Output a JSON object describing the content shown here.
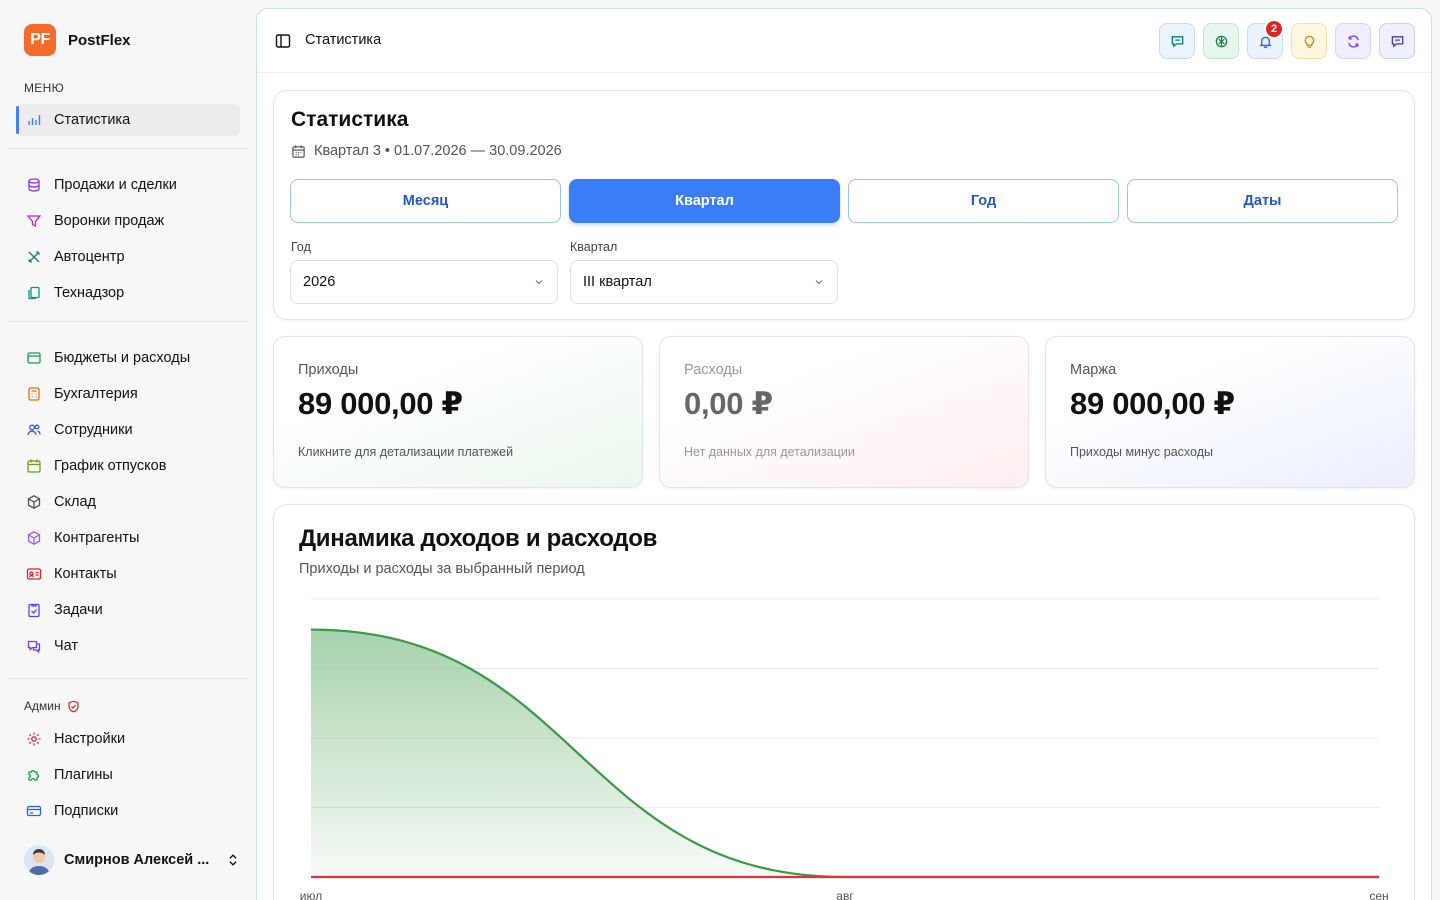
{
  "app": {
    "logo_text": "PF",
    "name": "PostFlex"
  },
  "sidebar": {
    "menu_label": "МЕНЮ",
    "items_main": [
      {
        "label": "Статистика",
        "icon": "bar-chart-icon"
      }
    ],
    "items_sales": [
      {
        "label": "Продажи и сделки",
        "icon": "database-icon"
      },
      {
        "label": "Воронки продаж",
        "icon": "funnel-icon"
      },
      {
        "label": "Автоцентр",
        "icon": "wrench-icon"
      },
      {
        "label": "Технадзор",
        "icon": "copy-icon"
      }
    ],
    "items_ops": [
      {
        "label": "Бюджеты и расходы",
        "icon": "wallet-icon"
      },
      {
        "label": "Бухгалтерия",
        "icon": "calculator-icon"
      },
      {
        "label": "Сотрудники",
        "icon": "users-icon"
      },
      {
        "label": "График отпусков",
        "icon": "calendar-icon"
      },
      {
        "label": "Склад",
        "icon": "box-icon"
      },
      {
        "label": "Контрагенты",
        "icon": "package-icon"
      },
      {
        "label": "Контакты",
        "icon": "contact-card-icon"
      },
      {
        "label": "Задачи",
        "icon": "clipboard-icon"
      },
      {
        "label": "Чат",
        "icon": "chat-icon"
      }
    ],
    "admin_label": "Админ",
    "items_admin": [
      {
        "label": "Настройки",
        "icon": "gear-icon"
      },
      {
        "label": "Плагины",
        "icon": "puzzle-icon"
      },
      {
        "label": "Подписки",
        "icon": "credit-card-icon"
      }
    ],
    "user_name": "Смирнов Алексей ..."
  },
  "topbar": {
    "breadcrumb": "Статистика",
    "notifications_count": "2"
  },
  "stats": {
    "title": "Статистика",
    "period": "Квартал 3 • 01.07.2026 — 30.09.2026",
    "tabs": [
      "Месяц",
      "Квартал",
      "Год",
      "Даты"
    ],
    "active_tab": "Квартал",
    "year_label": "Год",
    "year_value": "2026",
    "quarter_label": "Квартал",
    "quarter_value": "III квартал"
  },
  "kpis": {
    "income": {
      "label": "Приходы",
      "value": "89 000,00 ₽",
      "note": "Кликните для детализации платежей"
    },
    "expense": {
      "label": "Расходы",
      "value": "0,00 ₽",
      "note": "Нет данных для детализации"
    },
    "margin": {
      "label": "Маржа",
      "value": "89 000,00 ₽",
      "note": "Приходы минус расходы"
    }
  },
  "chart": {
    "title": "Динамика доходов и расходов",
    "subtitle": "Приходы и расходы за выбранный период"
  },
  "chart_data": {
    "type": "area",
    "categories": [
      "июл",
      "авг",
      "сен"
    ],
    "series": [
      {
        "values": [
          89000,
          0,
          0
        ],
        "color": "#3a9a45"
      },
      {
        "values": [
          0,
          0,
          0
        ],
        "color": "#e0323a"
      }
    ],
    "ylim": [
      0,
      100000
    ],
    "grid": true,
    "colors": {
      "income": "#3a9a45",
      "expense": "#e0323a"
    }
  }
}
